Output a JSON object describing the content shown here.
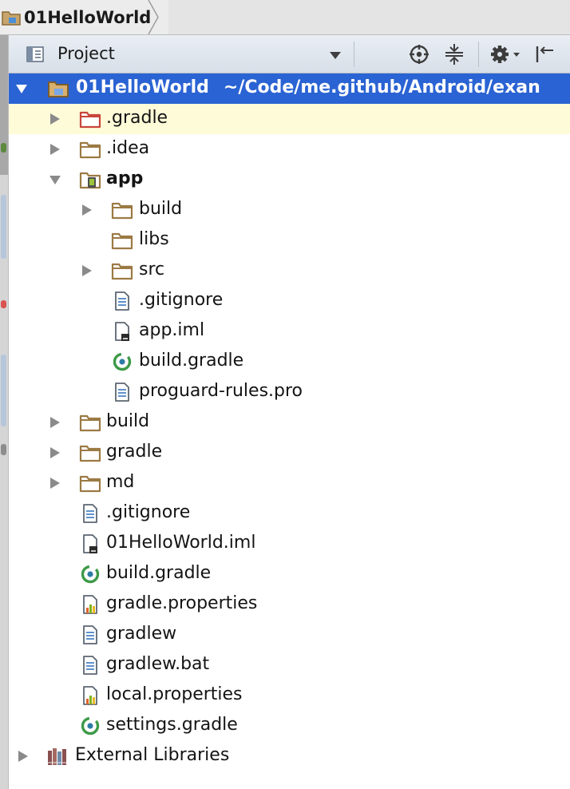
{
  "breadcrumb": {
    "project_name": "01HelloWorld"
  },
  "toolwindow": {
    "view_label": "Project"
  },
  "colors": {
    "selection": "#2a63d3",
    "highlight_row": "#fefbd8",
    "folder_brown": "#9c7a44",
    "excluded_red": "#c9453b",
    "gradle_green": "#3d9a48",
    "module_green": "#7fb31e"
  },
  "tree": {
    "root": {
      "name": "01HelloWorld",
      "path": "~/Code/me.github/Android/exan"
    },
    "items": [
      {
        "label": ".gradle",
        "icon": "excluded-folder-icon",
        "expanded": false
      },
      {
        "label": ".idea",
        "icon": "folder-icon",
        "expanded": false
      },
      {
        "label": "app",
        "icon": "android-module-icon",
        "expanded": true
      },
      {
        "label": "build",
        "icon": "folder-icon",
        "expanded": false
      },
      {
        "label": "libs",
        "icon": "folder-icon"
      },
      {
        "label": "src",
        "icon": "folder-icon",
        "expanded": false
      },
      {
        "label": ".gitignore",
        "icon": "text-file-icon"
      },
      {
        "label": "app.iml",
        "icon": "iml-file-icon"
      },
      {
        "label": "build.gradle",
        "icon": "gradle-file-icon"
      },
      {
        "label": "proguard-rules.pro",
        "icon": "text-file-icon"
      },
      {
        "label": "build",
        "icon": "folder-icon",
        "expanded": false
      },
      {
        "label": "gradle",
        "icon": "folder-icon",
        "expanded": false
      },
      {
        "label": "md",
        "icon": "folder-icon",
        "expanded": false
      },
      {
        "label": ".gitignore",
        "icon": "text-file-icon"
      },
      {
        "label": "01HelloWorld.iml",
        "icon": "iml-file-icon"
      },
      {
        "label": "build.gradle",
        "icon": "gradle-file-icon"
      },
      {
        "label": "gradle.properties",
        "icon": "properties-file-icon"
      },
      {
        "label": "gradlew",
        "icon": "text-file-icon"
      },
      {
        "label": "gradlew.bat",
        "icon": "text-file-icon"
      },
      {
        "label": "local.properties",
        "icon": "properties-file-icon"
      },
      {
        "label": "settings.gradle",
        "icon": "gradle-file-icon"
      },
      {
        "label": "External Libraries",
        "icon": "libraries-icon",
        "expanded": false
      }
    ]
  }
}
